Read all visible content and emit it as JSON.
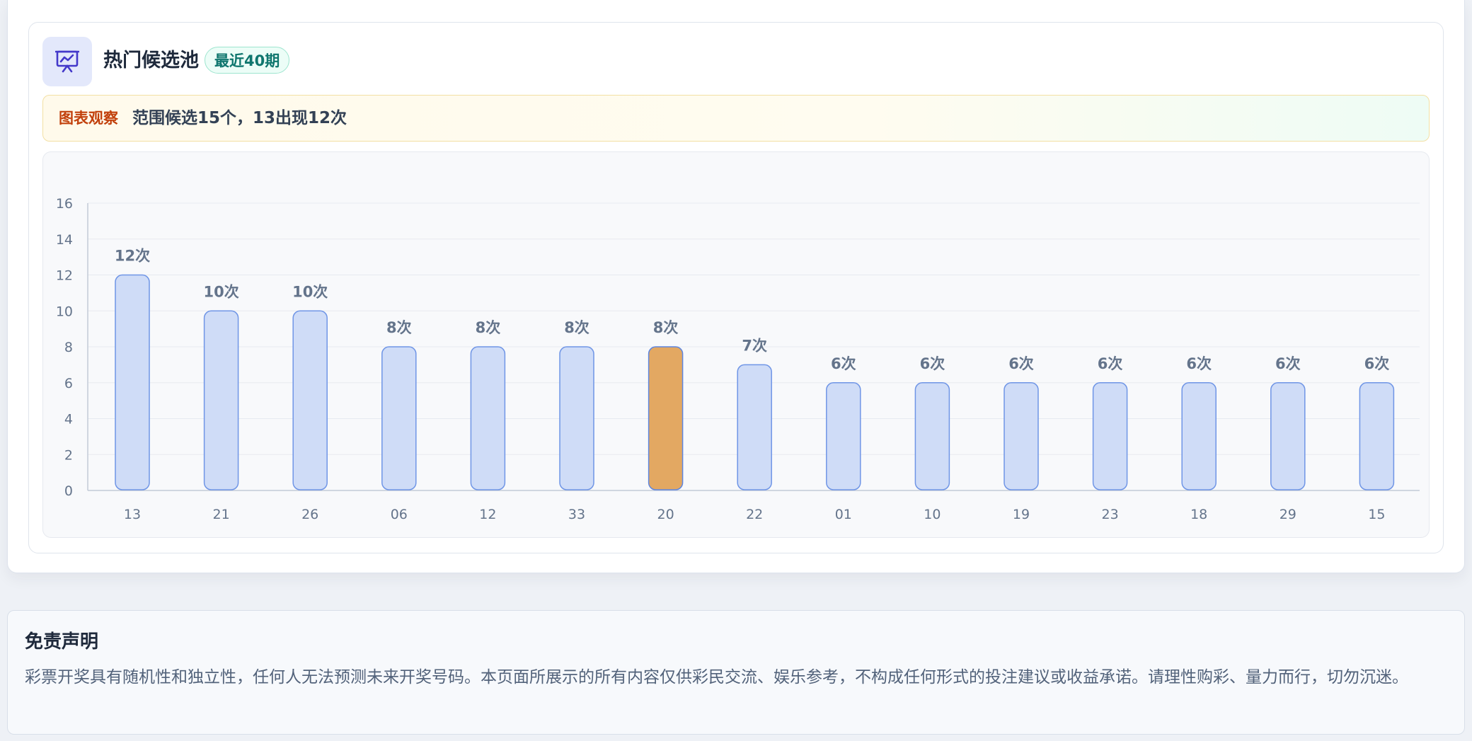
{
  "header": {
    "title": "热门候选池",
    "badge": "最近40期",
    "icon": "presentation-chart-icon"
  },
  "insight": {
    "label": "图表观察",
    "text": "范围候选15个，13出现12次"
  },
  "colors": {
    "bar_fill": "#cfdcf7",
    "bar_stroke": "#6f95e6",
    "highlight_fill": "#e3a862",
    "highlight_stroke": "#5e86e0",
    "label_color": "#64748b",
    "badge_text": "#0f766e",
    "insight_label": "#c2410c",
    "icon_color": "#4338ca"
  },
  "chart_data": {
    "type": "bar",
    "categories": [
      "13",
      "21",
      "26",
      "06",
      "12",
      "33",
      "20",
      "22",
      "01",
      "10",
      "19",
      "23",
      "18",
      "29",
      "15"
    ],
    "values": [
      12,
      10,
      10,
      8,
      8,
      8,
      8,
      7,
      6,
      6,
      6,
      6,
      6,
      6,
      6
    ],
    "data_labels": [
      "12次",
      "10次",
      "10次",
      "8次",
      "8次",
      "8次",
      "8次",
      "7次",
      "6次",
      "6次",
      "6次",
      "6次",
      "6次",
      "6次",
      "6次"
    ],
    "highlighted_category": "20",
    "ylim": [
      0,
      16
    ],
    "yticks": [
      "0",
      "2",
      "4",
      "6",
      "8",
      "10",
      "12",
      "14",
      "16"
    ],
    "grid": true,
    "title": "",
    "xlabel": "",
    "ylabel": ""
  },
  "disclaimer": {
    "title": "免责声明",
    "text": "彩票开奖具有随机性和独立性，任何人无法预测未来开奖号码。本页面所展示的所有内容仅供彩民交流、娱乐参考，不构成任何形式的投注建议或收益承诺。请理性购彩、量力而行，切勿沉迷。"
  }
}
